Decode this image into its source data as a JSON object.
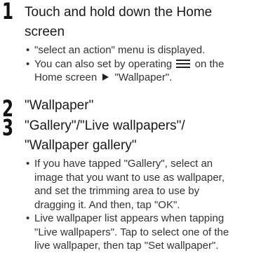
{
  "steps": [
    {
      "number": "1",
      "title_lines": [
        "Touch and hold down the Home",
        "screen"
      ],
      "bullets": [
        [
          "\"select an action\" menu is displayed."
        ],
        [
          "You can also set by operating",
          "on the",
          "Home screen",
          "\"Wallpaper\"."
        ]
      ]
    },
    {
      "number": "2",
      "title_lines": [
        "\"Wallpaper\""
      ]
    },
    {
      "number": "3",
      "title_lines": [
        "\"Gallery\"/\"Live wallpapers\"/",
        "\"Wallpaper gallery\""
      ],
      "bullets": [
        [
          "If you have tapped \"Gallery\", select  an",
          "image that you want to use as wallpaper,",
          "and set the trimming area to use by",
          "dragging it. And then, tap \"OK\"."
        ],
        [
          "Live wallpaper list appears when tapping",
          "\"Live wallpapers\". Tap to select one of the",
          "live wallpaper, then tap \"Set wallpaper\"."
        ]
      ]
    }
  ],
  "icons": {
    "bullet": "•",
    "menu": "menu-icon",
    "arrow": "right-triangle-arrow-icon"
  }
}
